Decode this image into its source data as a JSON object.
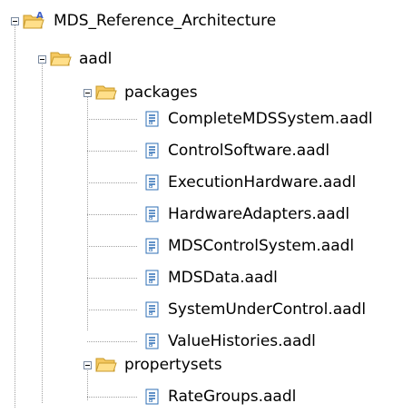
{
  "tree": {
    "project": {
      "label": "MDS_Reference_Architecture",
      "icon": "project-folder-icon",
      "expanded": true
    },
    "aadl_folder": {
      "label": "aadl",
      "icon": "open-folder-icon",
      "expanded": true
    },
    "packages_folder": {
      "label": "packages",
      "icon": "open-folder-icon",
      "expanded": true,
      "files": [
        "CompleteMDSSystem.aadl",
        "ControlSoftware.aadl",
        "ExecutionHardware.aadl",
        "HardwareAdapters.aadl",
        "MDSControlSystem.aadl",
        "MDSData.aadl",
        "SystemUnderControl.aadl",
        "ValueHistories.aadl"
      ]
    },
    "propertysets_folder": {
      "label": "propertysets",
      "icon": "open-folder-icon",
      "expanded": true,
      "files": [
        "RateGroups.aadl"
      ]
    },
    "file_icon": "aadl-file-icon",
    "colors": {
      "folder": "#f5c860",
      "folder_dark": "#c89a2a",
      "project_accent": "#3d5fc8",
      "file_icon": "#2f6fb5"
    }
  }
}
